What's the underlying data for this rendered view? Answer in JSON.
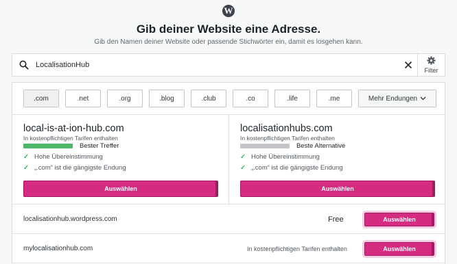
{
  "logo_icon": "wordpress-logo-icon",
  "logo_letter": "W",
  "heading": "Gib deiner Website eine Adresse.",
  "subheading": "Gib den Namen deiner Website oder passende Stichwörter ein, damit es losgehen kann.",
  "search": {
    "value": "LocalisationHub",
    "clear_icon": "close-icon",
    "search_icon": "search-icon"
  },
  "filter": {
    "label": "Filter",
    "icon": "gear-icon"
  },
  "tlds": [
    ".com",
    ".net",
    ".org",
    ".blog",
    ".club",
    ".co",
    ".life",
    ".me"
  ],
  "more_tlds_label": "Mehr Endungen",
  "featured": [
    {
      "domain": "local-is-at-ion-hub.com",
      "included": "In kostenpflichtigen Tarifen enthalten",
      "match_label": "Bester Treffer",
      "match_level": 1.0,
      "match_color": "#4ab866",
      "reasons": [
        "Hohe Übereinstimmung",
        "„.com“ ist die gängigste Endung"
      ],
      "button": "Auswählen"
    },
    {
      "domain": "localisationhubs.com",
      "included": "In kostenpflichtigen Tarifen enthalten",
      "match_label": "Beste Alternative",
      "match_level": 1.0,
      "match_color": "#c3c4c7",
      "reasons": [
        "Hohe Übereinstimmung",
        "„.com“ ist die gängigste Endung"
      ],
      "button": "Auswählen"
    }
  ],
  "results": [
    {
      "domain": "localisationhub.wordpress.com",
      "price": "Free",
      "button": "Auswählen"
    },
    {
      "domain": "mylocalisationhub.com",
      "price": "In kostenpflichtigen Tarifen enthalten",
      "button": "Auswählen"
    }
  ],
  "colors": {
    "accent": "#d52c82",
    "check": "#00a32a"
  }
}
